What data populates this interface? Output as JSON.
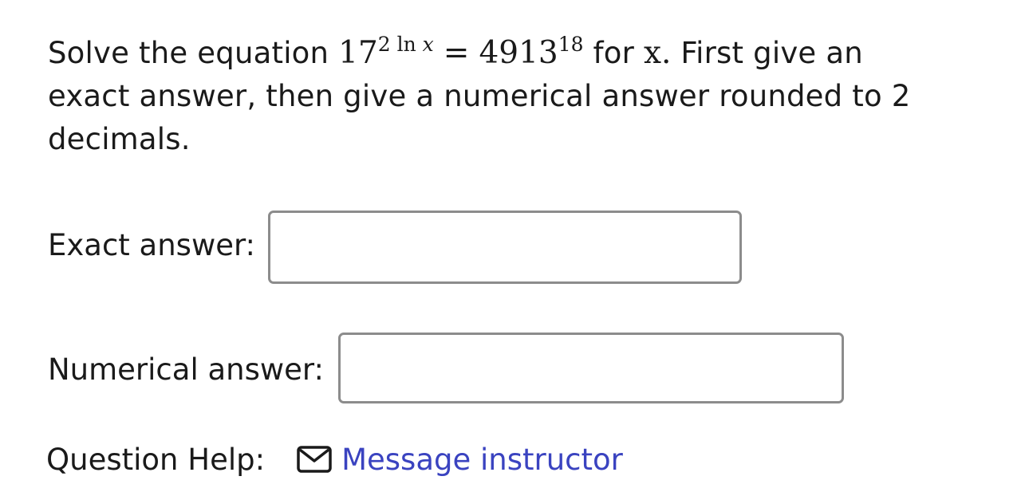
{
  "question": {
    "intro": "Solve the equation ",
    "base": "17",
    "exponent": "2 ln ",
    "exponent_var": "x",
    "equals": "=",
    "rhs_base": "4913",
    "rhs_exponent": "18",
    "for_text": " for ",
    "variable": "x",
    "period": ".",
    "instructions": " First give an exact answer, then give a numerical answer rounded to 2 decimals."
  },
  "exact_answer": {
    "label": "Exact answer:",
    "value": ""
  },
  "numerical_answer": {
    "label": "Numerical answer:",
    "value": ""
  },
  "help": {
    "label": "Question Help:",
    "icon": "mail-icon",
    "link_text": "Message instructor"
  },
  "colors": {
    "link": "#3a43c0",
    "input_border": "#8c8c8c",
    "text": "#1a1a1a"
  }
}
